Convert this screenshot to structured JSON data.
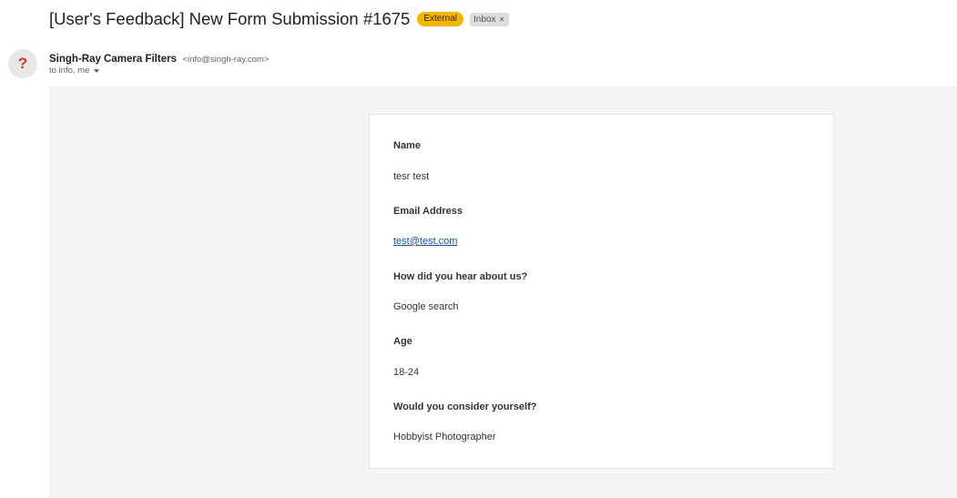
{
  "subject": "[User's Feedback] New Form Submission #1675",
  "labels": {
    "external": "External",
    "inbox": "Inbox",
    "inbox_remove": "×"
  },
  "sender": {
    "avatar_text": "?",
    "name": "Singh-Ray Camera Filters",
    "email": "<info@singh-ray.com>",
    "recipients": "to info, me"
  },
  "form": {
    "fields": [
      {
        "label": "Name",
        "value": "tesr test"
      },
      {
        "label": "Email Address",
        "value": "test@test.com"
      },
      {
        "label": "How did you hear about us?",
        "value": "Google search"
      },
      {
        "label": "Age",
        "value": "18-24"
      },
      {
        "label": "Would you consider yourself?",
        "value": "Hobbyist Photographer"
      }
    ]
  },
  "colors": {
    "external_badge": "#f5b400",
    "inbox_badge": "#dddddd",
    "avatar_mark": "#d93025",
    "link": "#1a4f9c",
    "body_background": "#f4f4f4"
  },
  "icons": {
    "avatar": "question-mark-icon",
    "recipients_toggle": "caret-down-icon",
    "label_remove": "close-icon"
  }
}
